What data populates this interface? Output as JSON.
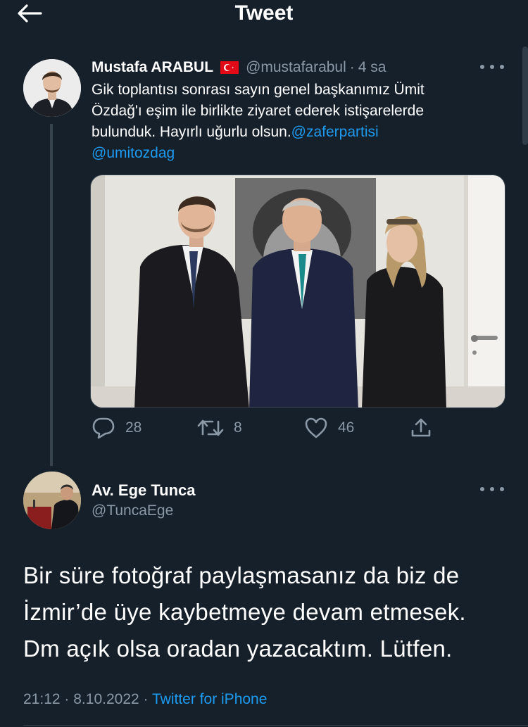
{
  "header": {
    "title": "Tweet"
  },
  "parent_tweet": {
    "author_name": "Mustafa ARABUL",
    "handle": "@mustafarabul",
    "separator": "·",
    "time_ago": "4 sa",
    "text_lines": [
      "Gik toplantısı sonrası sayın genel başkanımız Ümit",
      "Özdağ'ı eşim ile birlikte ziyaret ederek istişarelerde",
      "bulunduk. Hayırlı uğurlu olsun."
    ],
    "mention_1": "@zaferpartisi",
    "mention_2": "@umitozdag",
    "reply_count": "28",
    "retweet_count": "8",
    "like_count": "46"
  },
  "reply_tweet": {
    "author_name": "Av. Ege Tunca",
    "handle": "@TuncaEge",
    "text_lines": [
      "Bir süre fotoğraf paylaşmasanız da biz de",
      "İzmir’de üye kaybetmeye devam etmesek.",
      "Dm açık olsa oradan yazacaktım. Lütfen."
    ],
    "time": "21:12",
    "separator": "·",
    "date": "8.10.2022",
    "separator_2": "·",
    "source": "Twitter for iPhone"
  },
  "colors": {
    "background": "#15202b",
    "link": "#1d9bf0",
    "muted": "#8b98a5",
    "divider": "#38444d",
    "flag_red": "#e30a17"
  }
}
